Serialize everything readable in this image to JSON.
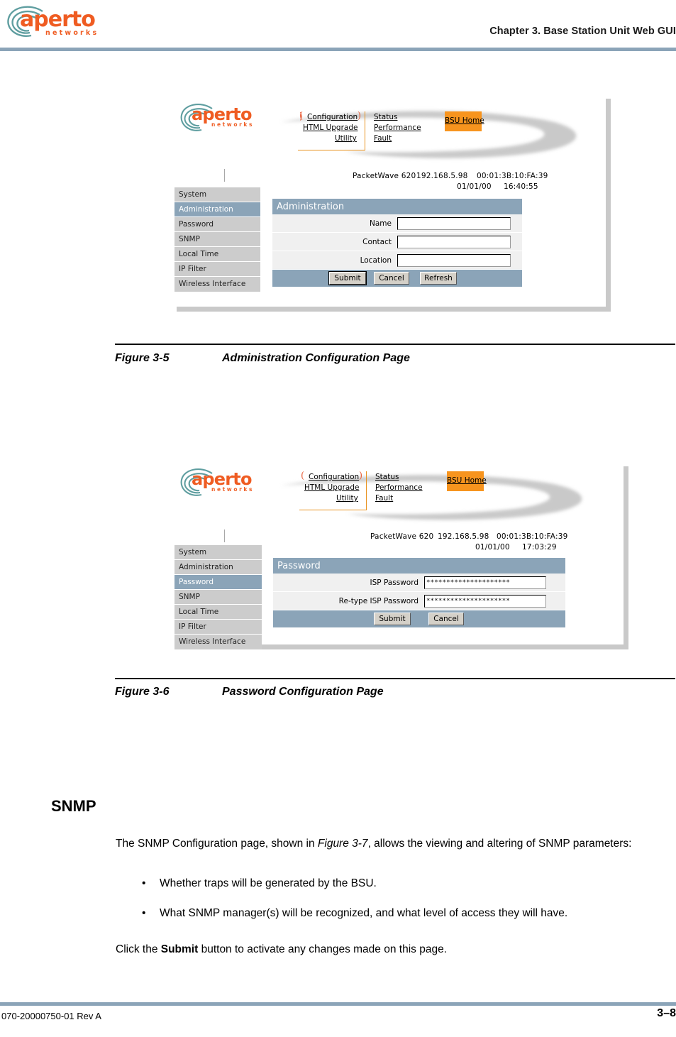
{
  "page": {
    "brand": {
      "name": "aperto",
      "tagline": "networks",
      "color": "#ef5c22"
    },
    "chapter_header": "Chapter 3.  Base Station Unit Web GUI",
    "footer_doc_id": "070-20000750-01 Rev A",
    "footer_page": "3–8"
  },
  "figures": [
    {
      "caption_number": "Figure 3-5",
      "caption_text": "Administration Configuration Page",
      "gui": {
        "logo_word": "aperto",
        "logo_sub": "networks",
        "nav_left": [
          "Configuration",
          "HTML Upgrade",
          "Utility"
        ],
        "nav_right": [
          "Status",
          "Performance",
          "Fault"
        ],
        "home_button": "BSU Home",
        "device_model": "PacketWave 620",
        "device_ip": "192.168.5.98",
        "device_mac": "00:01:3B:10:FA:39",
        "device_date": "01/01/00",
        "device_time": "16:40:55",
        "menu": [
          "System",
          "Administration",
          "Password",
          "SNMP",
          "Local Time",
          "IP Filter",
          "Wireless Interface"
        ],
        "menu_selected": "Administration",
        "panel_title": "Administration",
        "fields": [
          {
            "label": "Name",
            "value": ""
          },
          {
            "label": "Contact",
            "value": ""
          },
          {
            "label": "Location",
            "value": ""
          }
        ],
        "buttons": [
          "Submit",
          "Cancel",
          "Refresh"
        ]
      }
    },
    {
      "caption_number": "Figure 3-6",
      "caption_text": "Password Configuration Page",
      "gui": {
        "logo_word": "aperto",
        "logo_sub": "networks",
        "nav_left": [
          "Configuration",
          "HTML Upgrade",
          "Utility"
        ],
        "nav_right": [
          "Status",
          "Performance",
          "Fault"
        ],
        "home_button": "BSU Home",
        "device_model": "PacketWave 620",
        "device_ip": "192.168.5.98",
        "device_mac": "00:01:3B:10:FA:39",
        "device_date": "01/01/00",
        "device_time": "17:03:29",
        "menu": [
          "System",
          "Administration",
          "Password",
          "SNMP",
          "Local Time",
          "IP Filter",
          "Wireless Interface"
        ],
        "menu_selected": "Password",
        "panel_title": "Password",
        "fields": [
          {
            "label": "ISP Password",
            "value": "*********************"
          },
          {
            "label": "Re-type ISP Password",
            "value": "*********************"
          }
        ],
        "buttons": [
          "Submit",
          "Cancel"
        ]
      }
    }
  ],
  "section": {
    "heading": "SNMP",
    "intro_before": "The SNMP Configuration page, shown in ",
    "intro_ref": "Figure 3-7",
    "intro_after": ", allows the viewing and altering of SNMP parameters:",
    "bullets": [
      "Whether traps will be generated by the BSU.",
      "What SNMP manager(s) will be recognized, and what level of access they will have."
    ],
    "closing_before": "Click the ",
    "closing_bold": "Submit",
    "closing_after": " button to activate any changes made on this page."
  }
}
